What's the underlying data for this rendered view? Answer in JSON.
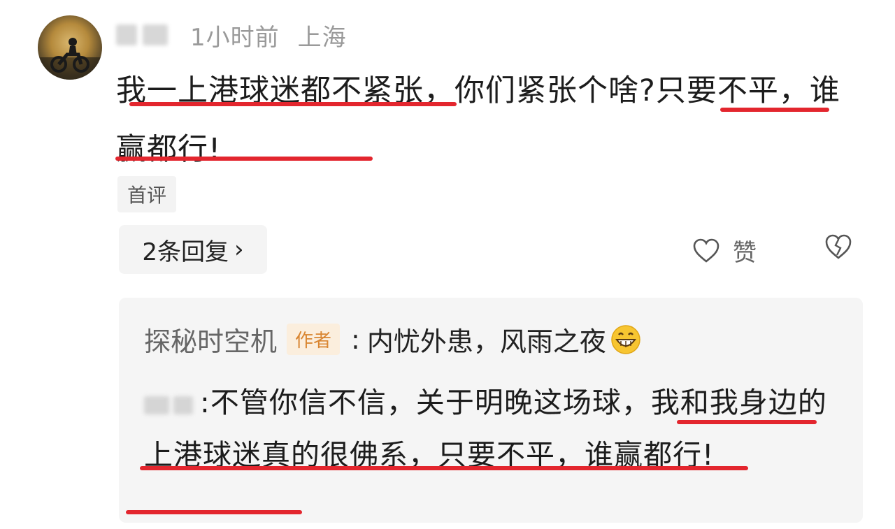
{
  "comment": {
    "time": "1小时前",
    "location": "上海",
    "text": "我一上港球迷都不紧张，你们紧张个啥?只要不平，谁赢都行!",
    "tag": "首评",
    "reply_count_label": "2条回复",
    "like_label": "赞"
  },
  "reply": {
    "author": "探秘时空机",
    "author_badge": "作者",
    "separator": ":",
    "text": "内忧外患，风雨之夜",
    "quoted_separator": ":",
    "quoted_text": "不管你信不信，关于明晚这场球，我和我身边的上港球迷真的很佛系，只要不平，谁赢都行!"
  },
  "colors": {
    "underline": "#e3262e",
    "badge_bg": "#fbeedd",
    "badge_text": "#d98632",
    "meta_text": "#9a9a9a"
  },
  "icons": {
    "avatar": "motorcycle-sunset-avatar",
    "like": "heart-outline-icon",
    "dislike": "broken-heart-icon",
    "reply_emoji": "grinning-face-icon",
    "chevron": "chevron-right-icon"
  }
}
